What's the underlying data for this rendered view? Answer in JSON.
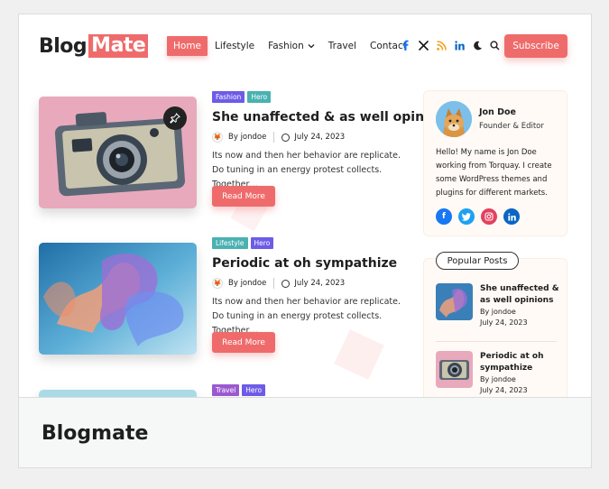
{
  "header": {
    "logo_part1": "Blog",
    "logo_part2": "Mate",
    "nav": [
      {
        "label": "Home",
        "active": true
      },
      {
        "label": "Lifestyle"
      },
      {
        "label": "Fashion",
        "dropdown": true
      },
      {
        "label": "Travel"
      },
      {
        "label": "Contact"
      }
    ],
    "social_icons": [
      "facebook-icon",
      "x-icon",
      "rss-icon",
      "linkedin-icon"
    ],
    "subscribe_label": "Subscribe"
  },
  "posts": [
    {
      "tags": [
        {
          "label": "Fashion",
          "color": "#6c5ce7"
        },
        {
          "label": "Hero",
          "color": "#4ab1b1"
        }
      ],
      "title": "She unaffected & as well opinions",
      "author": "By jondoe",
      "date": "July 24, 2023",
      "excerpt": "Its now and then her behavior are replicate. Do tuning in an energy protest collects. Together…",
      "read_more": "Read More"
    },
    {
      "tags": [
        {
          "label": "Lifestyle",
          "color": "#4ab1b1"
        },
        {
          "label": "Hero",
          "color": "#6c5ce7"
        }
      ],
      "title": "Periodic at oh sympathize",
      "author": "By jondoe",
      "date": "July 24, 2023",
      "excerpt": "Its now and then her behavior are replicate. Do tuning in an energy protest collects. Together…",
      "read_more": "Read More"
    },
    {
      "tags": [
        {
          "label": "Travel",
          "color": "#9b59d0"
        },
        {
          "label": "Hero",
          "color": "#6c5ce7"
        }
      ]
    }
  ],
  "author_card": {
    "name": "Jon Doe",
    "role": "Founder & Editor",
    "bio": "Hello! My name is Jon Doe working from Torquay. I create some WordPress themes and plugins for different markets.",
    "social": [
      {
        "icon": "facebook-icon",
        "color": "#1877f2"
      },
      {
        "icon": "twitter-icon",
        "color": "#1da1f2"
      },
      {
        "icon": "instagram-icon",
        "color": "#e4405f"
      },
      {
        "icon": "linkedin-icon",
        "color": "#0a66c2"
      }
    ]
  },
  "popular": {
    "heading": "Popular Posts",
    "items": [
      {
        "title": "She unaffected & as well opinions",
        "author": "By jondoe",
        "date": "July 24, 2023"
      },
      {
        "title": "Periodic at oh sympathize",
        "author": "By jondoe",
        "date": "July 24, 2023"
      }
    ]
  },
  "footer": {
    "title": "Blogmate"
  },
  "colors": {
    "accent": "#ef6b6b",
    "card_bg": "#fffaf5"
  }
}
